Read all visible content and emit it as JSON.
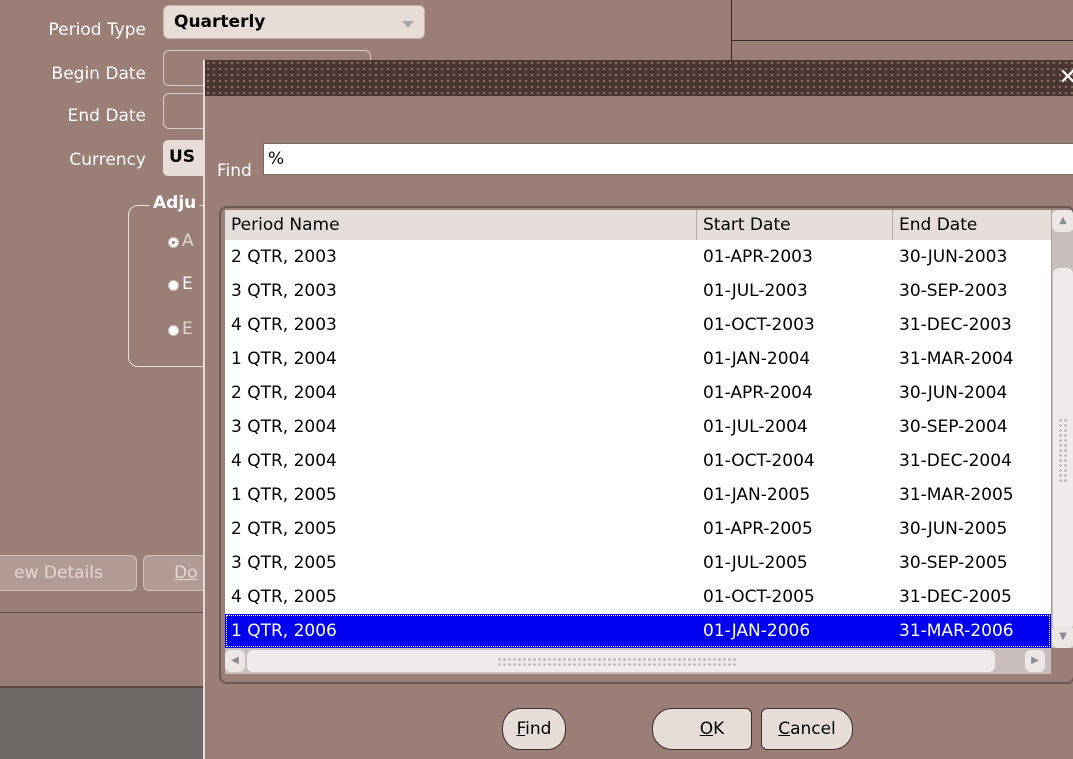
{
  "form": {
    "period_type_label": "Period Type",
    "period_type_value": "Quarterly",
    "begin_date_label": "Begin Date",
    "end_date_label": "End Date",
    "currency_label": "Currency",
    "currency_value": "US",
    "adjustment_group_label": "Adju",
    "radio_options": [
      "A",
      "E",
      "E"
    ],
    "view_details_button": "ew Details",
    "do_button": "Do"
  },
  "dialog": {
    "close_glyph": "✕",
    "find_label": "Find",
    "find_value": "%",
    "columns": [
      "Period Name",
      "Start Date",
      "End Date"
    ],
    "rows": [
      {
        "period": "2 QTR, 2003",
        "start": "01-APR-2003",
        "end": "30-JUN-2003"
      },
      {
        "period": "3 QTR, 2003",
        "start": "01-JUL-2003",
        "end": "30-SEP-2003"
      },
      {
        "period": "4 QTR, 2003",
        "start": "01-OCT-2003",
        "end": "31-DEC-2003"
      },
      {
        "period": "1 QTR, 2004",
        "start": "01-JAN-2004",
        "end": "31-MAR-2004"
      },
      {
        "period": "2 QTR, 2004",
        "start": "01-APR-2004",
        "end": "30-JUN-2004"
      },
      {
        "period": "3 QTR, 2004",
        "start": "01-JUL-2004",
        "end": "30-SEP-2004"
      },
      {
        "period": "4 QTR, 2004",
        "start": "01-OCT-2004",
        "end": "31-DEC-2004"
      },
      {
        "period": "1 QTR, 2005",
        "start": "01-JAN-2005",
        "end": "31-MAR-2005"
      },
      {
        "period": "2 QTR, 2005",
        "start": "01-APR-2005",
        "end": "30-JUN-2005"
      },
      {
        "period": "3 QTR, 2005",
        "start": "01-JUL-2005",
        "end": "30-SEP-2005"
      },
      {
        "period": "4 QTR, 2005",
        "start": "01-OCT-2005",
        "end": "31-DEC-2005"
      },
      {
        "period": "1 QTR, 2006",
        "start": "01-JAN-2006",
        "end": "31-MAR-2006"
      }
    ],
    "selected_row": "1 QTR, 2006",
    "buttons": {
      "find_mnemonic": "F",
      "find_rest": "ind",
      "ok_mnemonic": "O",
      "ok_rest": "K",
      "cancel_mnemonic": "C",
      "cancel_rest": "ancel"
    }
  },
  "colors": {
    "background": "#9b7e76",
    "title_bar": "#4a3630",
    "selection": "#0000f0",
    "list_background": "#ffffff"
  },
  "icons": [
    "dropdown-arrow-icon",
    "close-icon",
    "scroll-up-icon",
    "scroll-down-icon",
    "scroll-left-icon",
    "scroll-right-icon"
  ]
}
